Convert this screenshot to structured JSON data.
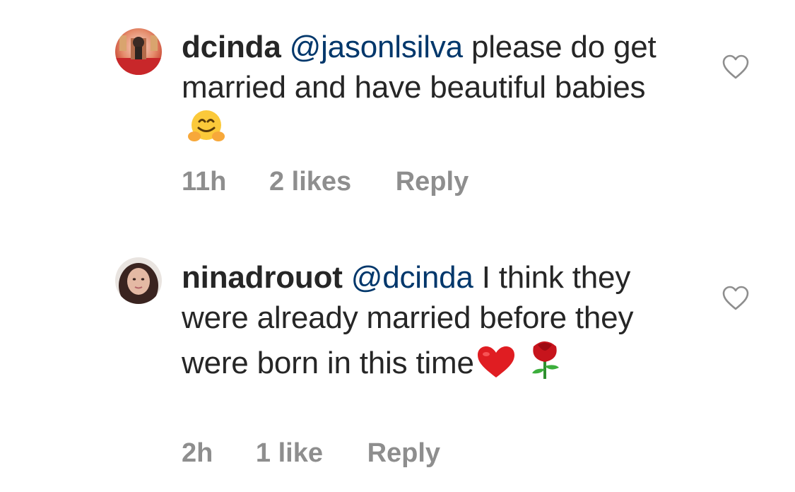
{
  "comments": [
    {
      "username": "dcinda",
      "mention": "@jasonlsilva",
      "text": "please do get married and have beautiful babies",
      "emoji": "hugging-face-emoji",
      "time": "11h",
      "likes": "2 likes",
      "reply_label": "Reply"
    },
    {
      "username": "ninadrouot",
      "mention": "@dcinda",
      "text": "I think they were already married before they were born in this time",
      "emoji": "red-heart-emoji rose-emoji",
      "time": "2h",
      "likes": "1 like",
      "reply_label": "Reply"
    }
  ],
  "colors": {
    "text": "#262626",
    "mention": "#00376b",
    "meta": "#8e8e8e",
    "heart_outline": "#8e8e8e"
  }
}
